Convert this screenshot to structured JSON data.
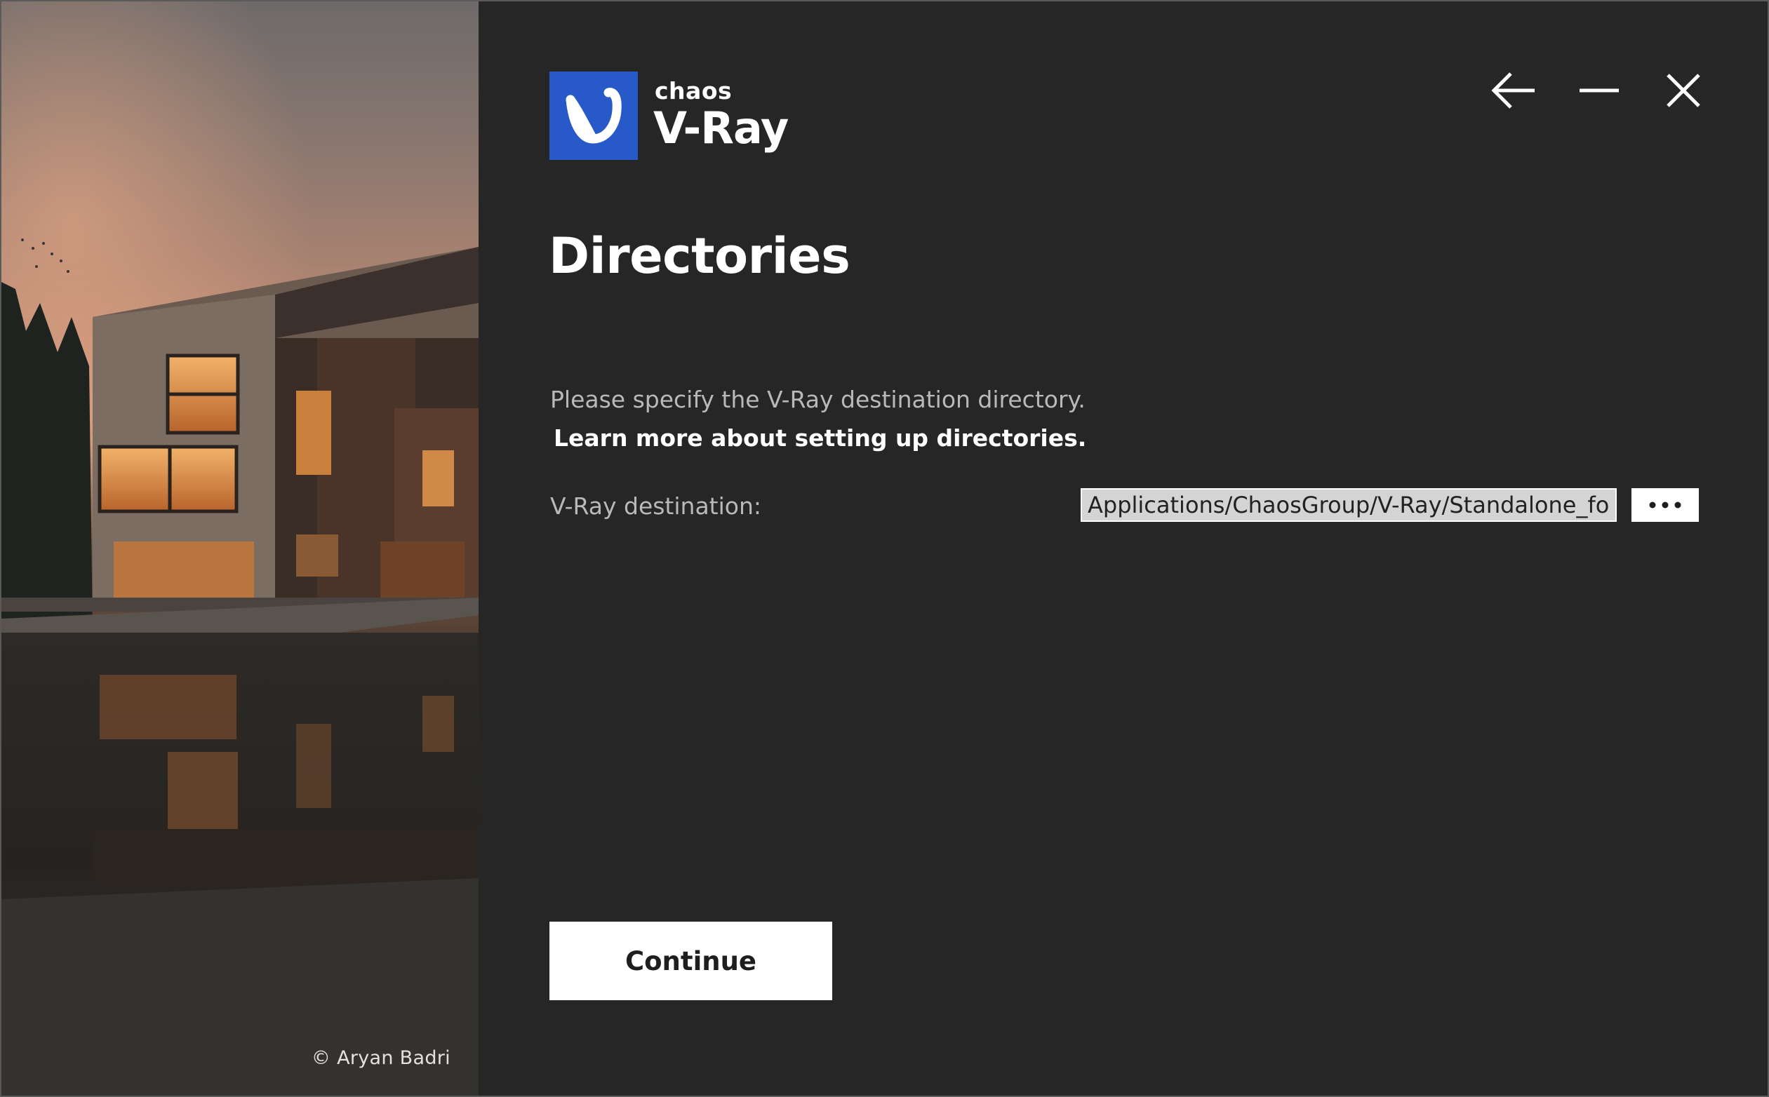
{
  "window": {
    "controls": {
      "back": "back-arrow-icon",
      "minimize": "minimize-icon",
      "close": "close-icon"
    }
  },
  "hero": {
    "credit": "© Aryan Badri"
  },
  "logo": {
    "brand": "chaos",
    "product": "V-Ray",
    "accent_color": "#2759c9"
  },
  "page": {
    "title": "Directories",
    "description": "Please specify the V-Ray destination directory.",
    "learn_more": "Learn more about setting up directories."
  },
  "form": {
    "destination_label": "V-Ray destination:",
    "destination_value": "Applications/ChaosGroup/V-Ray/Standalone_for_",
    "browse_icon": "ellipsis-icon"
  },
  "actions": {
    "continue_label": "Continue"
  }
}
